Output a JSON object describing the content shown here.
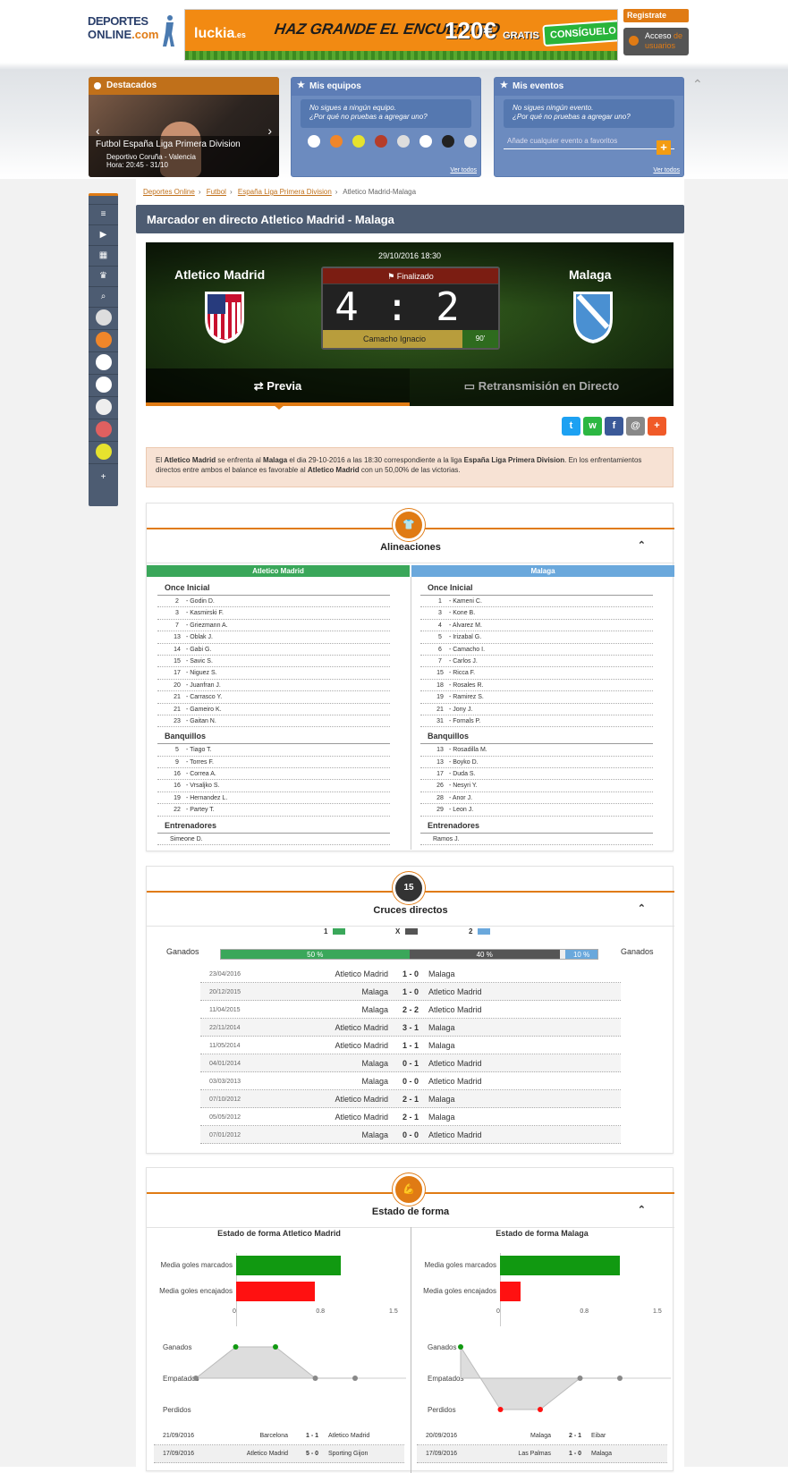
{
  "site": {
    "logo_line1": "DEPORTES",
    "logo_line2a": "ONLINE",
    "logo_line2b": ".com"
  },
  "banner": {
    "brand": "luckia",
    "brand_tld": ".es",
    "slogan": "HAZ GRANDE EL ENCUENTRO",
    "amount": "120€",
    "amount_sub": "GRATIS",
    "cta": "CONSÍGUELO"
  },
  "auth": {
    "register": "Registrate",
    "access_a": "Acceso",
    "access_b": "de",
    "access_c": "usuarios"
  },
  "destacados": {
    "title": "Destacados",
    "headline": "Futbol España Liga Primera Division",
    "match": "Deportivo Coruña - Valencia",
    "time": "Hora: 20:45 - 31/10"
  },
  "mis_equipos": {
    "title": "Mis equipos",
    "msg1": "No sigues a ningún equipo.",
    "msg2": "¿Por qué no pruebas a agregar uno?",
    "link": "Ver todos"
  },
  "mis_eventos": {
    "title": "Mis eventos",
    "msg1": "No sigues ningún evento.",
    "msg2": "¿Por qué no pruebas a agregar uno?",
    "placeholder": "Añade cualquier evento a favoritos",
    "link": "Ver todos"
  },
  "breadcrumb": [
    "Deportes Online",
    "Futbol",
    "España Liga Primera Division",
    "Atletico Madrid-Malaga"
  ],
  "page_title": "Marcador en directo Atletico Madrid - Malaga",
  "match": {
    "datetime": "29/10/2016 18:30",
    "home": "Atletico Madrid",
    "away": "Malaga",
    "status": "Finalizado",
    "home_score": "4",
    "sep": ":",
    "away_score": "2",
    "referee": "Camacho Ignacio",
    "minute": "90'"
  },
  "tabs": {
    "preview": "Previa",
    "live": "Retransmisión en Directo"
  },
  "share": [
    "t",
    "w",
    "f",
    "@",
    "+"
  ],
  "info": {
    "p1": "El ",
    "t1": "Atletico Madrid",
    "p2": " se enfrenta al ",
    "t2": "Malaga",
    "p3": " el dia 29-10-2016 a las 18:30 correspondiente a la liga ",
    "t3": "España Liga Primera Division",
    "p4": ". En los enfrentamientos directos entre ambos el balance es favorable al ",
    "t4": "Atletico Madrid",
    "p5": " con un 50,00% de las victorias."
  },
  "lineups": {
    "title": "Alineaciones",
    "home_team": "Atletico Madrid",
    "away_team": "Malaga",
    "g_start": "Once Inicial",
    "g_bench": "Banquillos",
    "g_coach": "Entrenadores",
    "home_start": [
      [
        "2",
        "Godin D."
      ],
      [
        "3",
        "Kasmirski F."
      ],
      [
        "7",
        "Griezmann A."
      ],
      [
        "13",
        "Oblak J."
      ],
      [
        "14",
        "Gabi G."
      ],
      [
        "15",
        "Savic S."
      ],
      [
        "17",
        "Niguez S."
      ],
      [
        "20",
        "Juanfran J."
      ],
      [
        "21",
        "Carrasco Y."
      ],
      [
        "21",
        "Gameiro K."
      ],
      [
        "23",
        "Gaitan N."
      ]
    ],
    "home_bench": [
      [
        "5",
        "Tiago T."
      ],
      [
        "9",
        "Torres F."
      ],
      [
        "16",
        "Correa A."
      ],
      [
        "16",
        "Vrsaljko S."
      ],
      [
        "19",
        "Hernandez L."
      ],
      [
        "22",
        "Partey T."
      ]
    ],
    "home_coach": "Simeone D.",
    "away_start": [
      [
        "1",
        "Kameni C."
      ],
      [
        "3",
        "Kone B."
      ],
      [
        "4",
        "Alvarez M."
      ],
      [
        "5",
        "Irizabal G."
      ],
      [
        "6",
        "Camacho I."
      ],
      [
        "7",
        "Carlos J."
      ],
      [
        "15",
        "Ricca F."
      ],
      [
        "18",
        "Rosales R."
      ],
      [
        "19",
        "Ramirez S."
      ],
      [
        "21",
        "Jony J."
      ],
      [
        "31",
        "Fornals P."
      ]
    ],
    "away_bench": [
      [
        "13",
        "Rosadilla M."
      ],
      [
        "13",
        "Boyko D."
      ],
      [
        "17",
        "Duda S."
      ],
      [
        "26",
        "Nesyri Y."
      ],
      [
        "28",
        "Anor J."
      ],
      [
        "29",
        "Leon J."
      ]
    ],
    "away_coach": "Ramos J."
  },
  "h2h": {
    "title": "Cruces directos",
    "icon": "15",
    "l1": "1",
    "lx": "X",
    "l2": "2",
    "ganados": "Ganados",
    "p1": "50 %",
    "px": "40 %",
    "p2": "10 %",
    "f1": 0.5,
    "fx": 0.4,
    "f2": 0.1,
    "matches": [
      [
        "23/04/2016",
        "Atletico Madrid",
        "1 - 0",
        "Malaga"
      ],
      [
        "20/12/2015",
        "Malaga",
        "1 - 0",
        "Atletico Madrid"
      ],
      [
        "11/04/2015",
        "Malaga",
        "2 - 2",
        "Atletico Madrid"
      ],
      [
        "22/11/2014",
        "Atletico Madrid",
        "3 - 1",
        "Malaga"
      ],
      [
        "11/05/2014",
        "Atletico Madrid",
        "1 - 1",
        "Malaga"
      ],
      [
        "04/01/2014",
        "Malaga",
        "0 - 1",
        "Atletico Madrid"
      ],
      [
        "03/03/2013",
        "Malaga",
        "0 - 0",
        "Atletico Madrid"
      ],
      [
        "07/10/2012",
        "Atletico Madrid",
        "2 - 1",
        "Malaga"
      ],
      [
        "05/05/2012",
        "Atletico Madrid",
        "2 - 1",
        "Malaga"
      ],
      [
        "07/01/2012",
        "Malaga",
        "0 - 0",
        "Atletico Madrid"
      ]
    ]
  },
  "form": {
    "title": "Estado de forma",
    "home_title": "Estado de forma Atletico Madrid",
    "away_title": "Estado de forma Malaga",
    "l_scored": "Media goles marcados",
    "l_conceded": "Media goles encajados",
    "ticks": [
      "0",
      "0.8",
      "1.5"
    ],
    "home_scored": 1.0,
    "home_conceded": 0.75,
    "away_scored": 1.15,
    "away_conceded": 0.2,
    "l_won": "Ganados",
    "l_draw": "Empatados",
    "l_lost": "Perdidos",
    "home_results": [
      "E",
      "G",
      "G",
      "E",
      "E"
    ],
    "away_results": [
      "G",
      "P",
      "P",
      "E",
      "E"
    ],
    "home_matches": [
      [
        "21/09/2016",
        "Barcelona",
        "1 - 1",
        "Atletico Madrid"
      ],
      [
        "17/09/2016",
        "Atletico Madrid",
        "5 - 0",
        "Sporting Gijon"
      ]
    ],
    "away_matches": [
      [
        "20/09/2016",
        "Malaga",
        "2 - 1",
        "Eibar"
      ],
      [
        "17/09/2016",
        "Las Palmas",
        "1 - 0",
        "Malaga"
      ]
    ]
  },
  "colors": {
    "orange": "#e07b14",
    "home": "#3aa75a",
    "away": "#6aa8dc",
    "draw": "#555555",
    "won": "#119911",
    "lost": "#ff1111"
  }
}
